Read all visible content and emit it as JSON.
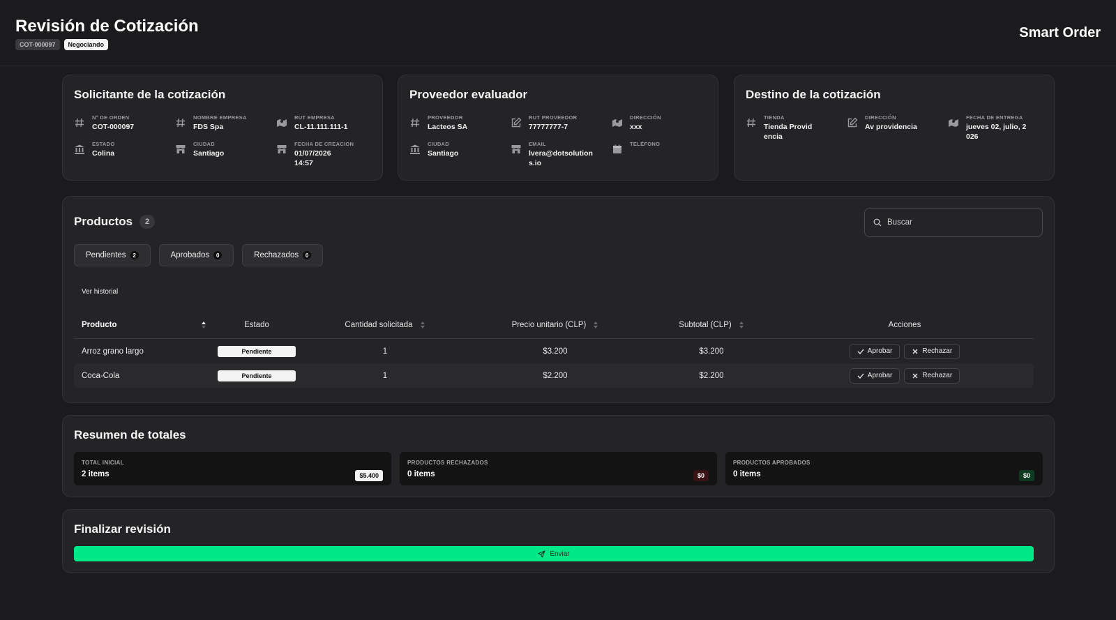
{
  "header": {
    "title": "Revisión de Cotización",
    "code": "COT-000097",
    "status": "Negociando",
    "brand": "Smart Order"
  },
  "solicitante": {
    "title": "Solicitante de la cotización",
    "items": [
      {
        "label": "N° DE ORDEN",
        "value": "COT-000097",
        "icon": "hash-icon"
      },
      {
        "label": "NOMBRE EMPRESA",
        "value": "FDS Spa",
        "icon": "hash-icon"
      },
      {
        "label": "RUT EMPRESA",
        "value": "CL-11.111.111-1",
        "icon": "map-icon"
      },
      {
        "label": "ESTADO",
        "value": "Colina",
        "icon": "bank-icon"
      },
      {
        "label": "CIUDAD",
        "value": "Santiago",
        "icon": "store-icon"
      },
      {
        "label": "FECHA DE CREACION",
        "value": "01/07/2026 14:57",
        "icon": "store-icon"
      }
    ]
  },
  "proveedor": {
    "title": "Proveedor evaluador",
    "items": [
      {
        "label": "PROVEEDOR",
        "value": "Lacteos SA",
        "icon": "hash-icon"
      },
      {
        "label": "RUT PROVEEDOR",
        "value": "77777777-7",
        "icon": "edit-icon"
      },
      {
        "label": "DIRECCIÓN",
        "value": "xxx",
        "icon": "map-icon"
      },
      {
        "label": "CIUDAD",
        "value": "Santiago",
        "icon": "bank-icon"
      },
      {
        "label": "EMAIL",
        "value": "lvera@dotsolutions.io",
        "icon": "store-icon"
      },
      {
        "label": "TELÉFONO",
        "value": "",
        "icon": "calendar-icon"
      }
    ]
  },
  "destino": {
    "title": "Destino de la cotización",
    "items": [
      {
        "label": "TIENDA",
        "value": "Tienda Providencia",
        "icon": "hash-icon"
      },
      {
        "label": "DIRECCIÓN",
        "value": "Av providencia",
        "icon": "edit-icon"
      },
      {
        "label": "FECHA DE ENTREGA",
        "value": "jueves 02, julio, 2026",
        "icon": "map-icon"
      }
    ]
  },
  "products": {
    "title": "Productos",
    "count": "2",
    "search_placeholder": "Buscar",
    "tabs": [
      {
        "label": "Pendientes",
        "count": "2"
      },
      {
        "label": "Aprobados",
        "count": "0"
      },
      {
        "label": "Rechazados",
        "count": "0"
      }
    ],
    "history_link": "Ver historial",
    "columns": {
      "producto": "Producto",
      "estado": "Estado",
      "cantidad": "Cantidad solicitada",
      "precio": "Precio unitario (CLP)",
      "subtotal": "Subtotal (CLP)",
      "acciones": "Acciones"
    },
    "rows": [
      {
        "producto": "Arroz grano largo",
        "estado": "Pendiente",
        "cantidad": "1",
        "precio": "$3.200",
        "subtotal": "$3.200"
      },
      {
        "producto": "Coca-Cola",
        "estado": "Pendiente",
        "cantidad": "1",
        "precio": "$2.200",
        "subtotal": "$2.200"
      }
    ],
    "approve_label": "Aprobar",
    "reject_label": "Rechazar"
  },
  "totals": {
    "title": "Resumen de totales",
    "boxes": [
      {
        "label": "TOTAL INICIAL",
        "items": "2 items",
        "amount": "$5.400",
        "color": "#f3f3f3",
        "text_color": "#111111"
      },
      {
        "label": "PRODUCTOS RECHAZADOS",
        "items": "0 items",
        "amount": "$0",
        "color": "#3a1216",
        "text_color": "#ffffff"
      },
      {
        "label": "PRODUCTOS APROBADOS",
        "items": "0 items",
        "amount": "$0",
        "color": "#0f3a22",
        "text_color": "#ffffff"
      }
    ]
  },
  "finalizar": {
    "title": "Finalizar revisión",
    "send_label": "Enviar",
    "accent": "#00e887"
  }
}
